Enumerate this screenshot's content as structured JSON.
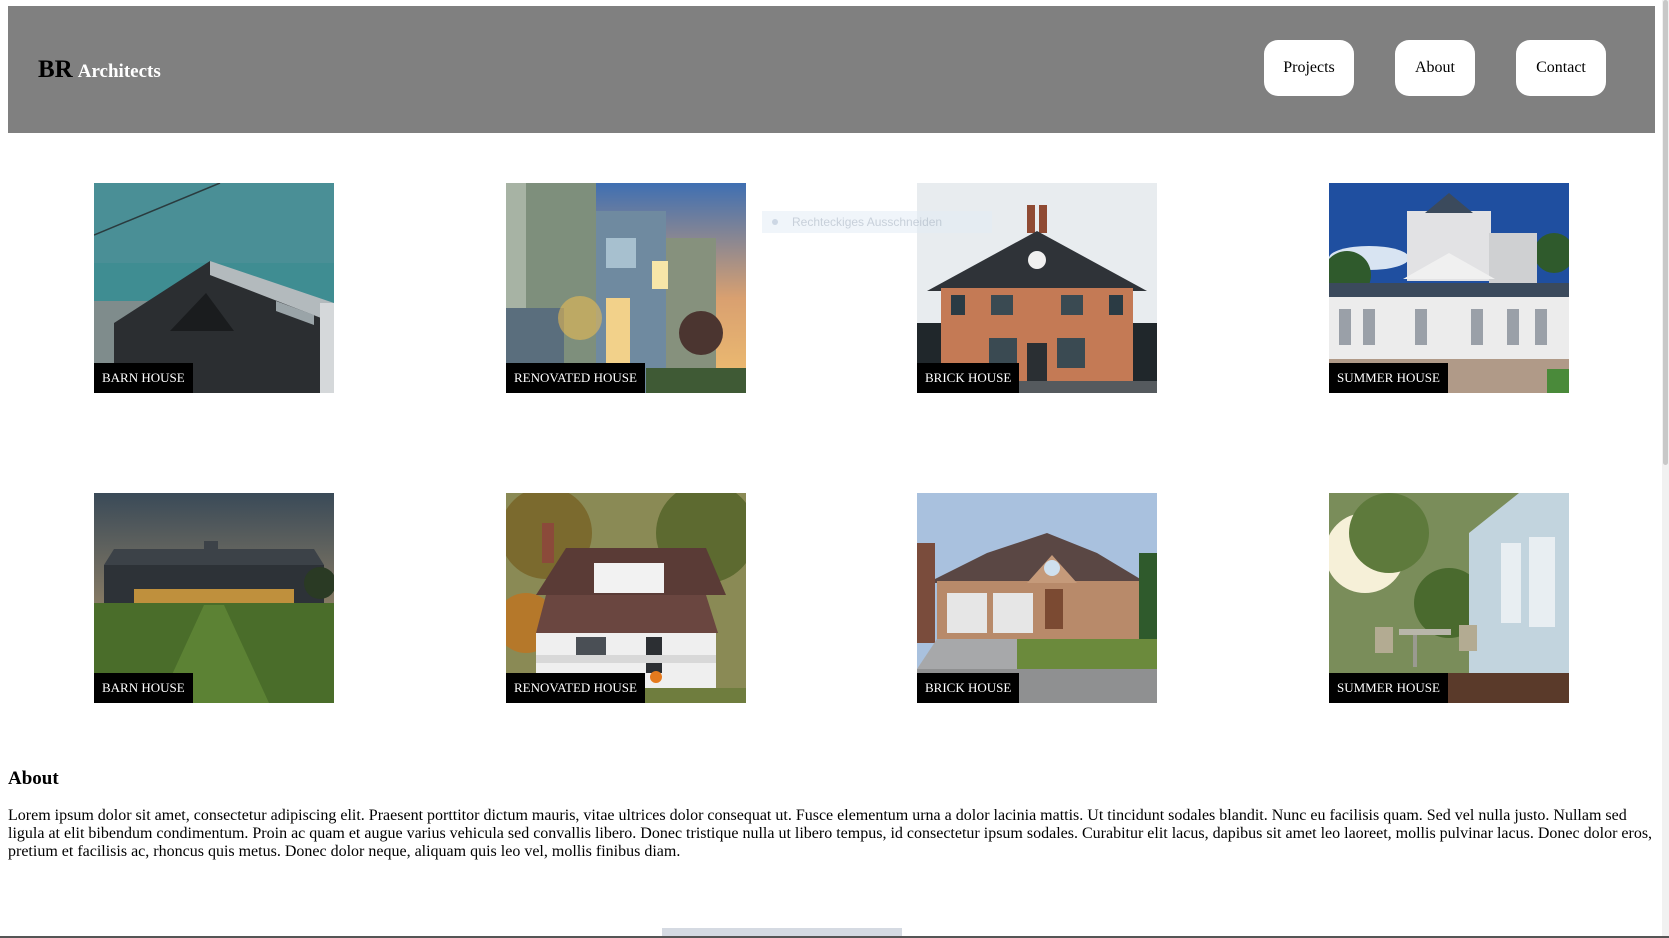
{
  "header": {
    "logo_br": "BR",
    "logo_architects": "Architects",
    "nav": {
      "projects": "Projects",
      "about": "About",
      "contact": "Contact"
    }
  },
  "projects": [
    {
      "caption": "BARN HOUSE"
    },
    {
      "caption": "RENOVATED HOUSE"
    },
    {
      "caption": "BRICK HOUSE"
    },
    {
      "caption": "SUMMER HOUSE"
    },
    {
      "caption": "BARN HOUSE"
    },
    {
      "caption": "RENOVATED HOUSE"
    },
    {
      "caption": "BRICK HOUSE"
    },
    {
      "caption": "SUMMER HOUSE"
    }
  ],
  "overlay": {
    "tooltip": "Rechteckiges Ausschneiden"
  },
  "about": {
    "title": "About",
    "text": "Lorem ipsum dolor sit amet, consectetur adipiscing elit. Praesent porttitor dictum mauris, vitae ultrices dolor consequat ut. Fusce elementum urna a dolor lacinia mattis. Ut tincidunt sodales blandit. Nunc eu facilisis quam. Sed vel nulla justo. Nullam sed ligula at elit bibendum condimentum. Proin ac quam et augue varius vehicula sed convallis libero. Donec tristique nulla ut libero tempus, id consectetur ipsum sodales. Curabitur elit lacus, dapibus sit amet leo laoreet, mollis pulvinar lacus. Donec dolor eros, pretium et facilisis ac, rhoncus quis metus. Donec dolor neque, aliquam quis leo vel, mollis finibus diam."
  },
  "colors": {
    "header_bg": "#808080",
    "caption_bg": "#000000",
    "button_bg": "#ffffff"
  }
}
